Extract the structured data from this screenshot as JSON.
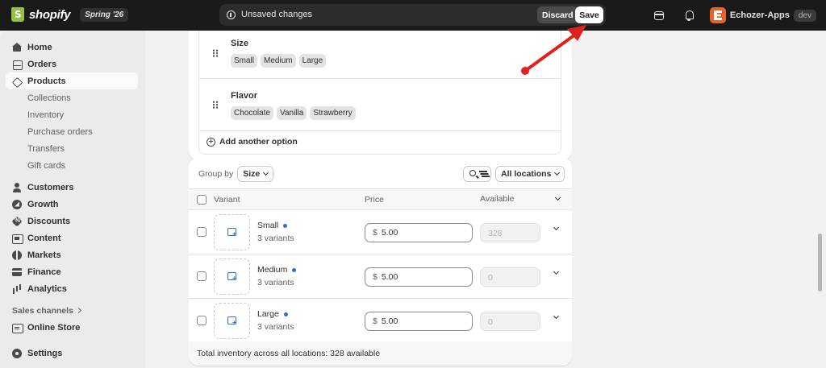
{
  "topbar": {
    "brand_name": "shopify",
    "edition_badge": "Spring '26",
    "unsaved_label": "Unsaved changes",
    "discard_label": "Discard",
    "save_label": "Save",
    "account_name": "Echozer-Apps",
    "account_badge": "dev"
  },
  "sidebar": {
    "items": [
      {
        "label": "Home",
        "icon": "home-icon"
      },
      {
        "label": "Orders",
        "icon": "orders-icon"
      },
      {
        "label": "Products",
        "icon": "tag-icon",
        "active": true
      },
      {
        "label": "Collections",
        "sub": true
      },
      {
        "label": "Inventory",
        "sub": true
      },
      {
        "label": "Purchase orders",
        "sub": true
      },
      {
        "label": "Transfers",
        "sub": true
      },
      {
        "label": "Gift cards",
        "sub": true
      },
      {
        "label": "Customers",
        "icon": "person-icon"
      },
      {
        "label": "Growth",
        "icon": "growth-icon"
      },
      {
        "label": "Discounts",
        "icon": "discount-icon"
      },
      {
        "label": "Content",
        "icon": "content-icon"
      },
      {
        "label": "Markets",
        "icon": "globe-icon"
      },
      {
        "label": "Finance",
        "icon": "bank-icon"
      },
      {
        "label": "Analytics",
        "icon": "bar-chart-icon"
      }
    ],
    "sales_channels_label": "Sales channels",
    "online_store_label": "Online Store",
    "settings_label": "Settings"
  },
  "options": [
    {
      "name": "Size",
      "values": [
        "Small",
        "Medium",
        "Large"
      ]
    },
    {
      "name": "Flavor",
      "values": [
        "Chocolate",
        "Vanilla",
        "Strawberry"
      ]
    }
  ],
  "add_option_label": "Add another option",
  "variants_card": {
    "group_by_label": "Group by",
    "group_by_value": "Size",
    "locations_label": "All locations",
    "headers": {
      "variant": "Variant",
      "price": "Price",
      "available": "Available"
    },
    "rows": [
      {
        "name": "Small",
        "count": "3 variants",
        "currency": "$",
        "price": "5.00",
        "available": "328"
      },
      {
        "name": "Medium",
        "count": "3 variants",
        "currency": "$",
        "price": "5.00",
        "available": "0"
      },
      {
        "name": "Large",
        "count": "3 variants",
        "currency": "$",
        "price": "5.00",
        "available": "0"
      }
    ],
    "footer": "Total inventory across all locations: 328 available"
  },
  "colors": {
    "topbar_bg": "#1a1a1a",
    "accent_blue": "#2c6ecb",
    "annotation_arrow": "#e0201f"
  }
}
